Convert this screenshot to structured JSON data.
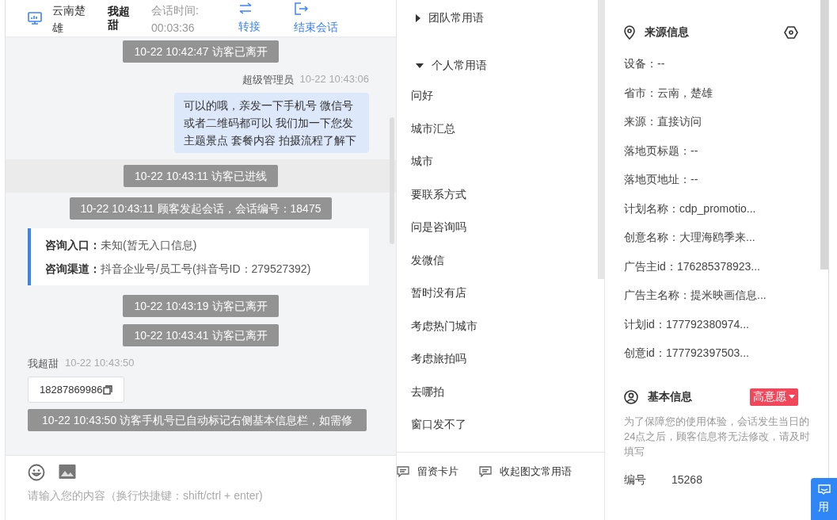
{
  "header": {
    "location": "云南楚雄",
    "visitor": "我超甜",
    "time_label": "会话时间:",
    "time": "00:03:36",
    "actions": [
      {
        "kind": "transfer",
        "label": "转接"
      },
      {
        "kind": "end",
        "label": "结束会话"
      }
    ]
  },
  "messages": [
    {
      "kind": "system",
      "text": "10-22 10:42:47 访客已离开",
      "highlighted": false
    },
    {
      "kind": "agent",
      "sender": "超级管理员",
      "time": "10-22 10:43:06",
      "text": "可以的哦，亲发一下手机号 微信号或者二维码都可以 我们加一下您发主题景点 套餐内容 拍摄流程了解下"
    },
    {
      "kind": "system",
      "text": "10-22 10:43:11 访客已进线",
      "highlighted": true
    },
    {
      "kind": "system",
      "text": "10-22 10:43:11 顾客发起会话，会话编号：18475",
      "highlighted": false
    },
    {
      "kind": "info",
      "lines": [
        {
          "label": "咨询入口：",
          "value": "未知(暂无入口信息)"
        },
        {
          "label": "咨询渠道：",
          "value": "抖音企业号/员工号(抖音号ID：279527392)"
        }
      ]
    },
    {
      "kind": "system",
      "text": "10-22 10:43:19 访客已离开",
      "highlighted": false
    },
    {
      "kind": "system",
      "text": "10-22 10:43:41 访客已离开",
      "highlighted": false
    },
    {
      "kind": "visitor",
      "sender": "我超甜",
      "time": "10-22 10:43:50",
      "text": "18287869986"
    },
    {
      "kind": "system",
      "text": "10-22 10:43:50 访客手机号已自动标记右侧基本信息栏，如需修",
      "highlighted": false
    }
  ],
  "composer": {
    "placeholder": "请输入您的内容（换行快捷键：shift/ctrl + enter)"
  },
  "phrases": {
    "groups": [
      {
        "title": "团队常用语",
        "expanded": false
      },
      {
        "title": "个人常用语",
        "expanded": true,
        "children": [
          {
            "label": "问好"
          },
          {
            "label": "城市汇总"
          },
          {
            "label": "城市"
          },
          {
            "label": "要联系方式"
          },
          {
            "label": "问是咨询吗"
          },
          {
            "label": "发微信"
          },
          {
            "label": "暂时没有店"
          },
          {
            "label": "考虑热门城市"
          },
          {
            "label": "考虑旅拍吗"
          },
          {
            "label": "去哪拍"
          },
          {
            "label": "窗口发不了"
          }
        ]
      }
    ],
    "actions": [
      {
        "label": "留资卡片"
      },
      {
        "label": "收起图文常用语"
      }
    ]
  },
  "source_info": {
    "title": "来源信息",
    "fields": [
      {
        "text": "设备：--"
      },
      {
        "text": "省市：云南，楚雄"
      },
      {
        "text": "来源：直接访问"
      },
      {
        "text": "落地页标题：--"
      },
      {
        "text": "落地页地址：--"
      },
      {
        "text": "计划名称：cdp_promotio..."
      },
      {
        "text": "创意名称：大理海鸥季来..."
      },
      {
        "text": "广告主id：176285378923..."
      },
      {
        "text": "广告主名称：提米映画信息..."
      },
      {
        "text": "计划id：177792380974..."
      },
      {
        "text": "创意id：177792397503..."
      }
    ]
  },
  "basic_info": {
    "title": "基本信息",
    "intent": "高意愿",
    "notice": "为了保障您的使用体验，会话发生当日的24点之后，顾客信息将无法修改，请及时填写",
    "fields": [
      {
        "label": "编号",
        "value": "15268"
      }
    ]
  },
  "float_button": {
    "label": "用"
  }
}
